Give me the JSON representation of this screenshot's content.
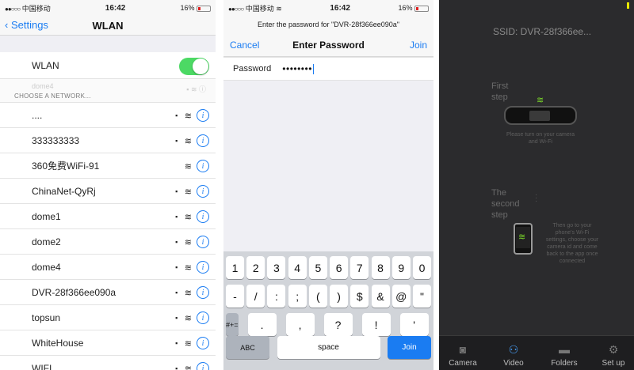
{
  "panel1": {
    "status": {
      "carrier": "中国移动",
      "time": "16:42",
      "battery": "16%"
    },
    "nav": {
      "back_label": "Settings",
      "title": "WLAN"
    },
    "wlan_label": "WLAN",
    "ghost_network": "dome4",
    "section_header": "CHOOSE A NETWORK...",
    "networks": [
      {
        "name": "....",
        "locked": true
      },
      {
        "name": "333333333",
        "locked": true
      },
      {
        "name": "360免费WiFi-91",
        "locked": false
      },
      {
        "name": "ChinaNet-QyRj",
        "locked": true
      },
      {
        "name": "dome1",
        "locked": true
      },
      {
        "name": "dome2",
        "locked": true
      },
      {
        "name": "dome4",
        "locked": true
      },
      {
        "name": "DVR-28f366ee090a",
        "locked": true
      },
      {
        "name": "topsun",
        "locked": true
      },
      {
        "name": "WhiteHouse",
        "locked": true
      },
      {
        "name": "WIFI",
        "locked": true
      }
    ],
    "colors": {
      "toggle_on": "#4cd964",
      "ios_blue": "#1a7cf2"
    }
  },
  "panel2": {
    "status": {
      "carrier": "中国移动",
      "time": "16:42",
      "battery": "16%"
    },
    "prompt": "Enter the password for \"DVR-28f366ee090a\"",
    "nav": {
      "cancel": "Cancel",
      "title": "Enter Password",
      "join": "Join"
    },
    "password_label": "Password",
    "password_value": "••••••••",
    "keyboard": {
      "row1": [
        "1",
        "2",
        "3",
        "4",
        "5",
        "6",
        "7",
        "8",
        "9",
        "0"
      ],
      "row2": [
        "-",
        "/",
        ":",
        ";",
        "(",
        ")",
        "$",
        "&",
        "@",
        "\""
      ],
      "row3_mode": "#+=",
      "row3": [
        ".",
        ",",
        "?",
        "!",
        "'"
      ],
      "abc": "ABC",
      "space": "space",
      "join": "Join"
    }
  },
  "panel3": {
    "ssid": "SSID: DVR-28f366ee...",
    "first_step": "First step",
    "first_caption": "Please turn on your camera and Wi-Fi",
    "second_step": "The second step",
    "second_caption": "Then go to your phone's Wi-Fi settings, choose your camera id and come back to the app once connected",
    "tabs": [
      {
        "label": "Camera",
        "icon": "camera-icon"
      },
      {
        "label": "Video",
        "icon": "video-icon"
      },
      {
        "label": "Folders",
        "icon": "folder-icon"
      },
      {
        "label": "Set up",
        "icon": "gear-icon"
      }
    ],
    "active_tab": "Video",
    "colors": {
      "accent": "#4aa3ff",
      "wifi_green": "#7cdc2a"
    }
  }
}
